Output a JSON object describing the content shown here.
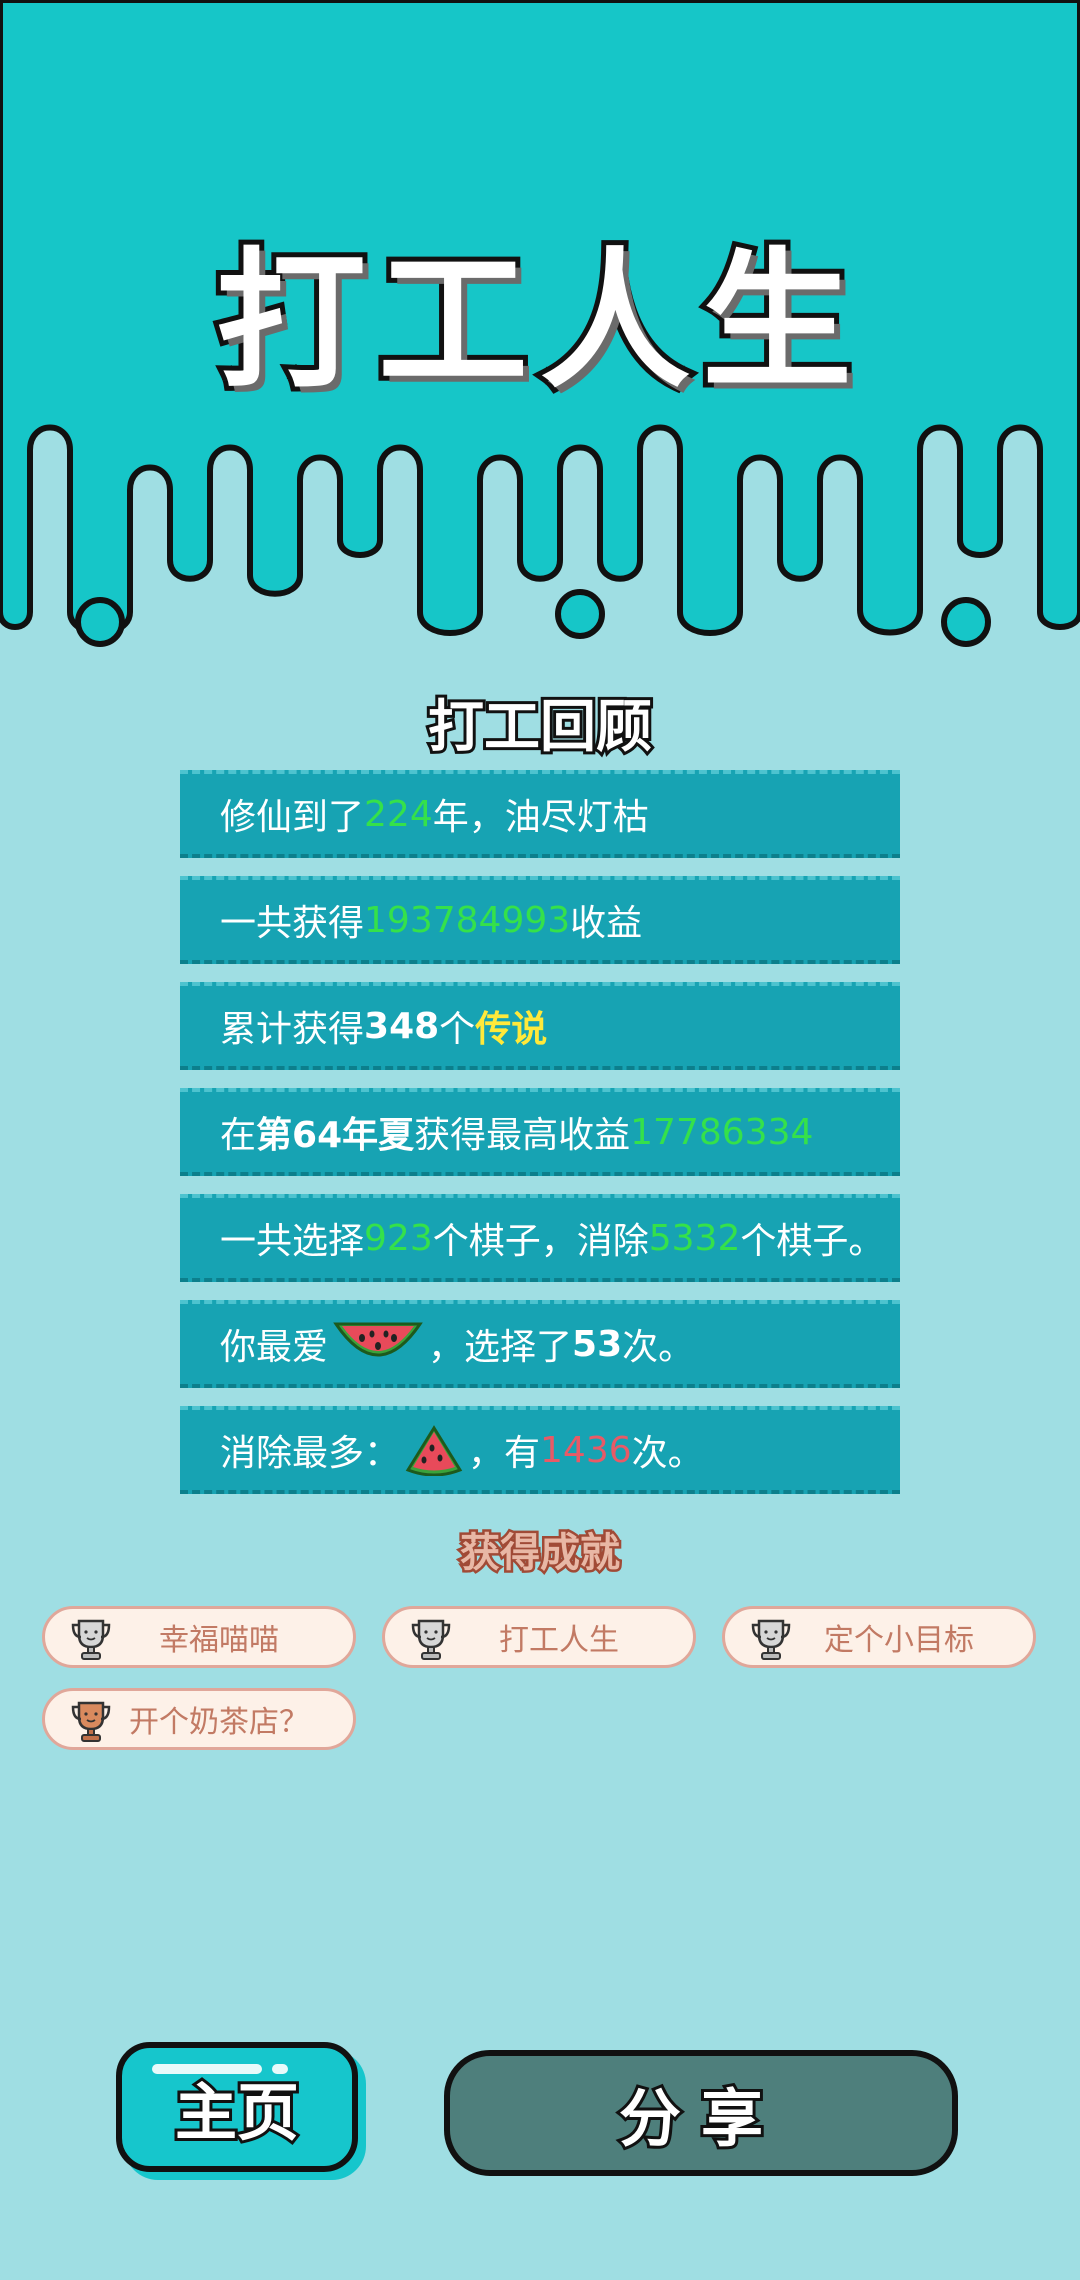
{
  "game_title": "打工人生",
  "review": {
    "title": "打工回顾",
    "rows": [
      {
        "parts": [
          "修仙到了",
          "224",
          "年，油尽灯枯"
        ]
      },
      {
        "parts": [
          "一共获得",
          "193784993",
          "收益"
        ]
      },
      {
        "parts": [
          "累计获得",
          "348",
          "个",
          "传说"
        ]
      },
      {
        "parts": [
          "在 ",
          "第64年夏",
          " 获得最高收益",
          "17786334"
        ]
      },
      {
        "parts": [
          "一共选择",
          "923",
          "个棋子，消除",
          "5332",
          "个棋子。"
        ]
      },
      {
        "parts": [
          "你最爱",
          "，选择了",
          "53",
          "次。"
        ],
        "icon": "watermelon-slice-icon"
      },
      {
        "parts": [
          "消除最多：",
          "，有",
          "1436",
          "次。"
        ],
        "icon": "watermelon-wedge-icon"
      }
    ]
  },
  "achievements": {
    "title": "获得成就",
    "items": [
      {
        "label": "幸福喵喵",
        "icon": "trophy-silver-icon"
      },
      {
        "label": "打工人生",
        "icon": "trophy-silver-icon"
      },
      {
        "label": "定个小目标",
        "icon": "trophy-silver-icon"
      },
      {
        "label": "开个奶茶店？",
        "icon": "trophy-bronze-icon"
      }
    ]
  },
  "buttons": {
    "home": "主页",
    "share": "分享"
  },
  "colors": {
    "background": "#9fdee3",
    "header": "#16c6c8",
    "row": "#17a3b3",
    "highlight_green": "#35e14a",
    "highlight_yellow": "#ffe93a",
    "highlight_red": "#e85a66"
  }
}
